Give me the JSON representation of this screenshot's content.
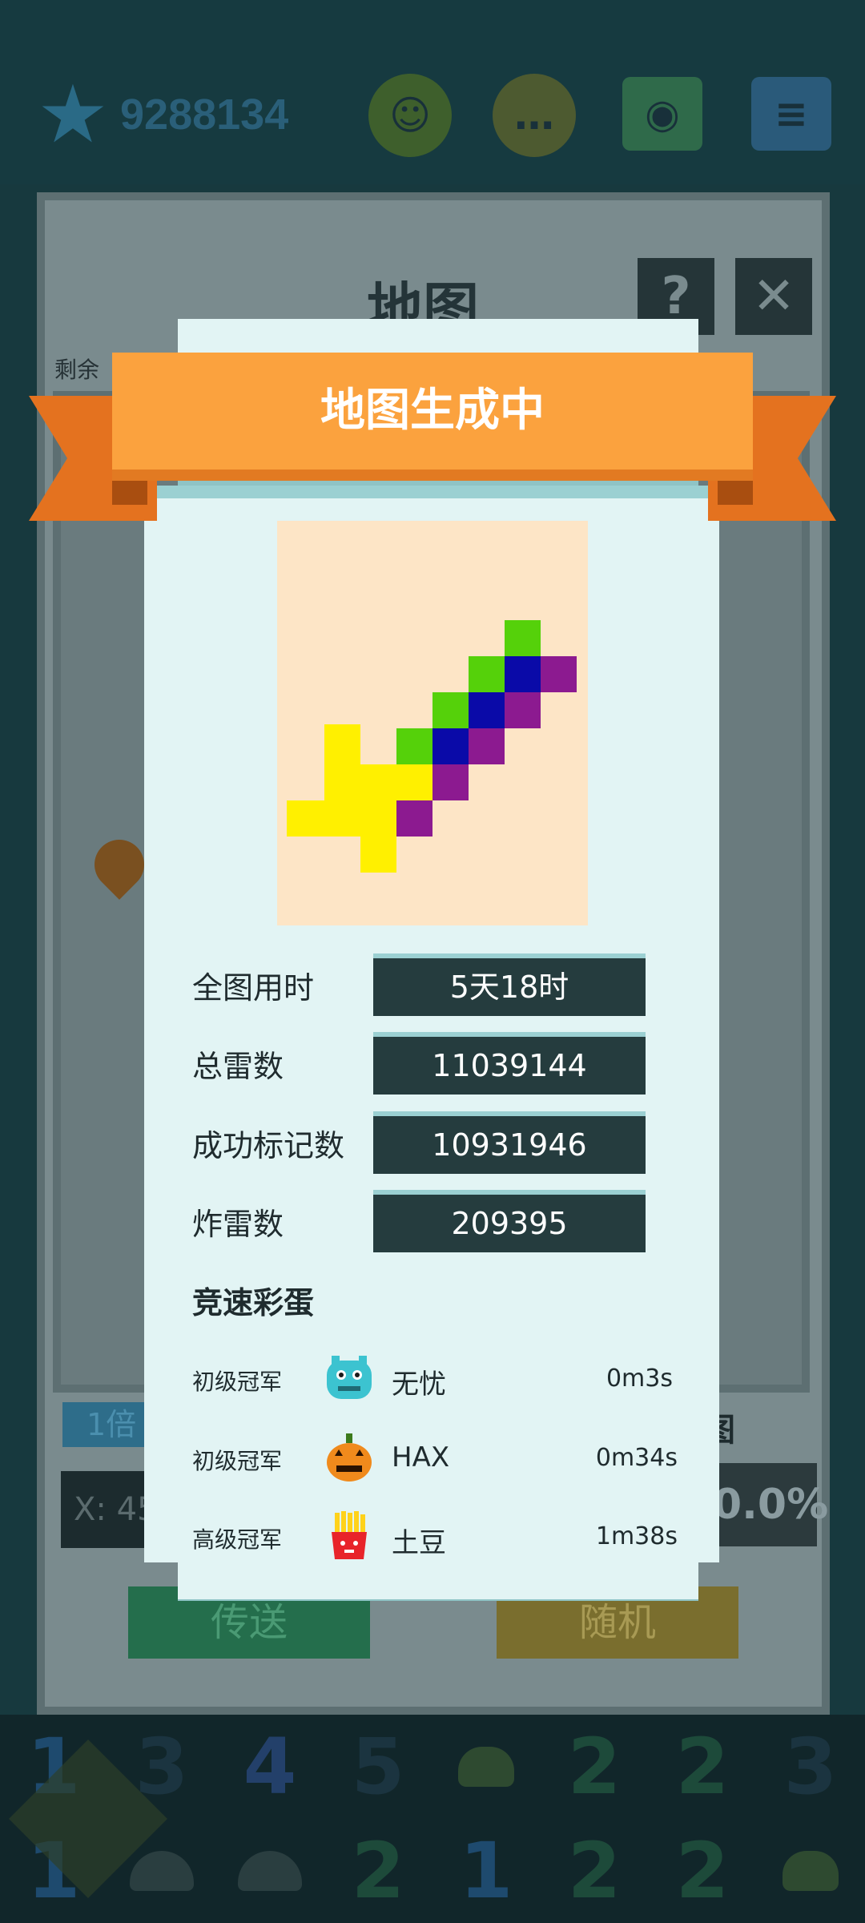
{
  "header": {
    "score": "9288134",
    "buttons": [
      {
        "icon": "smiley-icon"
      },
      {
        "icon": "chat-icon"
      },
      {
        "icon": "map-pin-icon"
      },
      {
        "icon": "menu-icon"
      }
    ]
  },
  "background_panel": {
    "title": "地图",
    "help_label": "?",
    "close_label": "✕",
    "remaining_label": "剩余",
    "zoom_label": "1倍",
    "map_label_fragment": "图",
    "coord_fragment": "X: 45",
    "percent_fragment": "0.0%",
    "teleport_label": "传送",
    "random_label": "随机"
  },
  "modal": {
    "title": "地图生成中",
    "stats": [
      {
        "label": "全图用时",
        "value": "5天18时"
      },
      {
        "label": "总雷数",
        "value": "11039144"
      },
      {
        "label": "成功标记数",
        "value": "10931946"
      },
      {
        "label": "炸雷数",
        "value": "209395"
      }
    ],
    "easter_egg_title": "竞速彩蛋",
    "winners": [
      {
        "rank": "初级冠军",
        "avatar": "monster-avatar-icon",
        "name": "无忧",
        "time": "0m3s"
      },
      {
        "rank": "初级冠军",
        "avatar": "pumpkin-avatar-icon",
        "name": "HAX",
        "time": "0m34s"
      },
      {
        "rank": "高级冠军",
        "avatar": "fries-avatar-icon",
        "name": "土豆",
        "time": "1m38s"
      }
    ]
  },
  "bottom_grid": {
    "row1": [
      "1",
      "3",
      "4",
      "5",
      "burger",
      "2",
      "2",
      "3"
    ],
    "row2": [
      "1",
      "blob",
      "blob",
      "2",
      "1",
      "2",
      "2",
      "burger"
    ]
  },
  "colors": {
    "ribbon": "#fba23e",
    "modal_bg": "#e2f4f4",
    "stat_box": "#253c3e",
    "art_bg": "#fde5c6"
  }
}
